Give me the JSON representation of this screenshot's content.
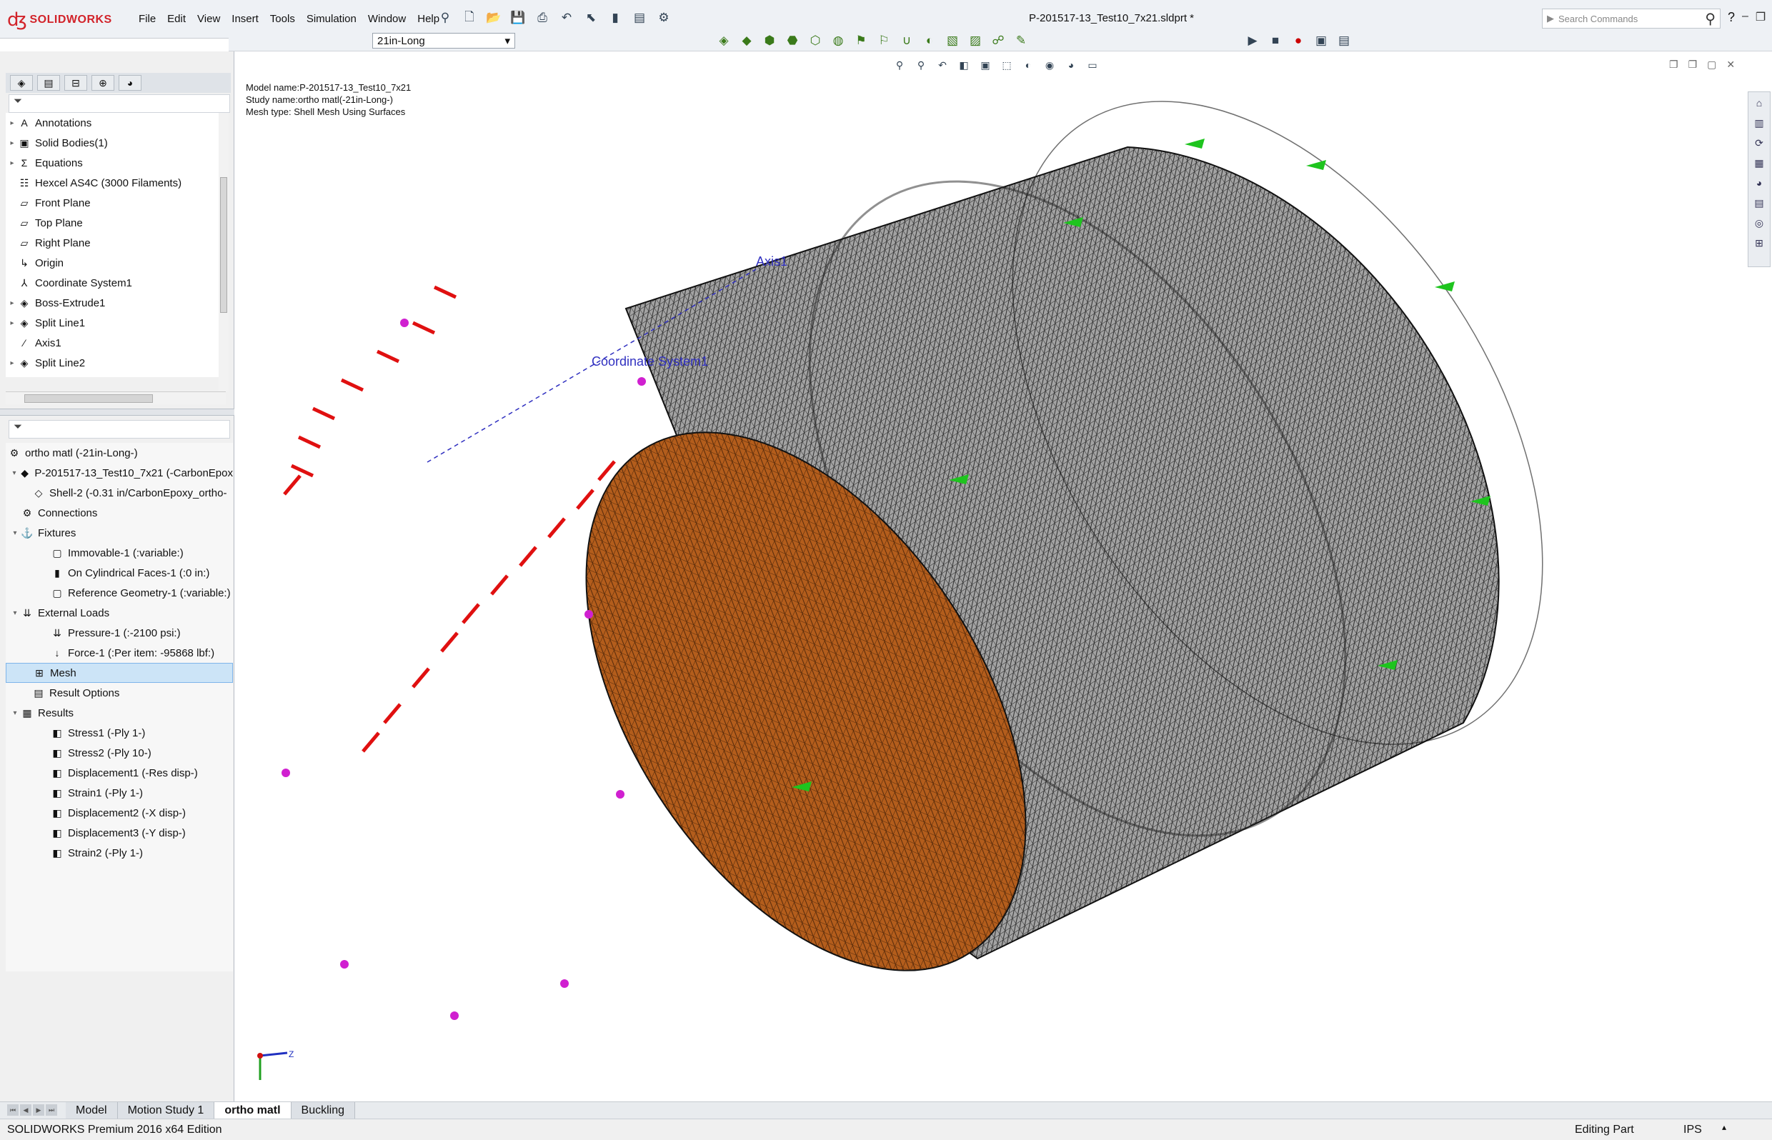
{
  "app": {
    "brand": "SOLIDWORKS",
    "document_title": "P-201517-13_Test10_7x21.sldprt *",
    "menu": [
      "File",
      "Edit",
      "View",
      "Insert",
      "Tools",
      "Simulation",
      "Window",
      "Help"
    ],
    "search_placeholder": "Search Commands",
    "help_label": "?"
  },
  "config": {
    "selected": "21in-Long"
  },
  "featuremanager": {
    "items": [
      {
        "label": "Annotations",
        "icon": "annotations-icon",
        "glyph": "A",
        "expandable": true
      },
      {
        "label": "Solid Bodies(1)",
        "icon": "solid-bodies-icon",
        "glyph": "▣",
        "expandable": true
      },
      {
        "label": "Equations",
        "icon": "equations-icon",
        "glyph": "Σ",
        "expandable": true
      },
      {
        "label": "Hexcel AS4C (3000 Filaments)",
        "icon": "material-icon",
        "glyph": "☷",
        "expandable": false
      },
      {
        "label": "Front Plane",
        "icon": "plane-icon",
        "glyph": "▱",
        "expandable": false
      },
      {
        "label": "Top Plane",
        "icon": "plane-icon",
        "glyph": "▱",
        "expandable": false
      },
      {
        "label": "Right Plane",
        "icon": "plane-icon",
        "glyph": "▱",
        "expandable": false
      },
      {
        "label": "Origin",
        "icon": "origin-icon",
        "glyph": "↳",
        "expandable": false
      },
      {
        "label": "Coordinate System1",
        "icon": "coordinate-system-icon",
        "glyph": "⅄",
        "expandable": false
      },
      {
        "label": "Boss-Extrude1",
        "icon": "extrude-icon",
        "glyph": "◈",
        "expandable": true
      },
      {
        "label": "Split Line1",
        "icon": "split-line-icon",
        "glyph": "◈",
        "expandable": true
      },
      {
        "label": "Axis1",
        "icon": "axis-icon",
        "glyph": "⁄",
        "expandable": false
      },
      {
        "label": "Split Line2",
        "icon": "split-line-icon",
        "glyph": "◈",
        "expandable": true
      }
    ]
  },
  "study_tree": {
    "root": "ortho matl (-21in-Long-)",
    "items": [
      {
        "label": "P-201517-13_Test10_7x21 (-CarbonEpox",
        "level": 1,
        "icon": "part-icon",
        "glyph": "◆",
        "expand": "▾"
      },
      {
        "label": "Shell-2 (-0.31 in/CarbonEpoxy_ortho-",
        "level": 2,
        "icon": "shell-icon",
        "glyph": "◇",
        "expand": ""
      },
      {
        "label": "Connections",
        "level": 1,
        "icon": "connections-icon",
        "glyph": "⚙",
        "expand": ""
      },
      {
        "label": "Fixtures",
        "level": 1,
        "icon": "fixtures-icon",
        "glyph": "⚓",
        "expand": "▾"
      },
      {
        "label": "Immovable-1 (:variable:)",
        "level": 3,
        "icon": "fixture-icon",
        "glyph": "▢",
        "expand": ""
      },
      {
        "label": "On Cylindrical Faces-1 (:0 in:)",
        "level": 3,
        "icon": "cylinder-fixture-icon",
        "glyph": "▮",
        "expand": ""
      },
      {
        "label": "Reference Geometry-1 (:variable:)",
        "level": 3,
        "icon": "fixture-icon",
        "glyph": "▢",
        "expand": ""
      },
      {
        "label": "External Loads",
        "level": 1,
        "icon": "external-loads-icon",
        "glyph": "⇊",
        "expand": "▾"
      },
      {
        "label": "Pressure-1 (:-2100 psi:)",
        "level": 3,
        "icon": "pressure-icon",
        "glyph": "⇊",
        "expand": ""
      },
      {
        "label": "Force-1 (:Per item: -95868 lbf:)",
        "level": 3,
        "icon": "force-icon",
        "glyph": "↓",
        "expand": ""
      },
      {
        "label": "Mesh",
        "level": 2,
        "icon": "mesh-icon",
        "glyph": "⊞",
        "expand": "",
        "selected": true
      },
      {
        "label": "Result Options",
        "level": 2,
        "icon": "result-options-icon",
        "glyph": "▤",
        "expand": ""
      },
      {
        "label": "Results",
        "level": 1,
        "icon": "results-folder-icon",
        "glyph": "▦",
        "expand": "▾"
      },
      {
        "label": "Stress1 (-Ply 1-)",
        "level": 3,
        "icon": "plot-icon",
        "glyph": "◧",
        "expand": ""
      },
      {
        "label": "Stress2 (-Ply 10-)",
        "level": 3,
        "icon": "plot-icon",
        "glyph": "◧",
        "expand": ""
      },
      {
        "label": "Displacement1 (-Res disp-)",
        "level": 3,
        "icon": "plot-icon",
        "glyph": "◧",
        "expand": ""
      },
      {
        "label": "Strain1 (-Ply 1-)",
        "level": 3,
        "icon": "plot-icon",
        "glyph": "◧",
        "expand": ""
      },
      {
        "label": "Displacement2 (-X disp-)",
        "level": 3,
        "icon": "plot-icon",
        "glyph": "◧",
        "expand": ""
      },
      {
        "label": "Displacement3 (-Y disp-)",
        "level": 3,
        "icon": "plot-icon",
        "glyph": "◧",
        "expand": ""
      },
      {
        "label": "Strain2 (-Ply 1-)",
        "level": 3,
        "icon": "plot-icon",
        "glyph": "◧",
        "expand": ""
      }
    ]
  },
  "viewport": {
    "info": [
      "Model name:P-201517-13_Test10_7x21",
      "Study name:ortho matl(-21in-Long-)",
      "Mesh type: Shell Mesh Using Surfaces"
    ],
    "axis_label": "Axis1",
    "coordsys_label": "Coordinate System1",
    "triad_z": "Z",
    "colors": {
      "inner": "#b05a1a",
      "outer": "#9a9a9a",
      "mesh": "#222222",
      "pressure": "#e01010",
      "fixture": "#1ec41e",
      "marker": "#d020d0",
      "axis": "#3030c0"
    }
  },
  "bottom_tabs": {
    "items": [
      {
        "label": "Model",
        "active": false
      },
      {
        "label": "Motion Study 1",
        "active": false
      },
      {
        "label": "ortho matl",
        "active": true
      },
      {
        "label": "Buckling",
        "active": false
      }
    ]
  },
  "status": {
    "edition": "SOLIDWORKS Premium 2016 x64 Edition",
    "mode": "Editing Part",
    "units": "IPS"
  }
}
